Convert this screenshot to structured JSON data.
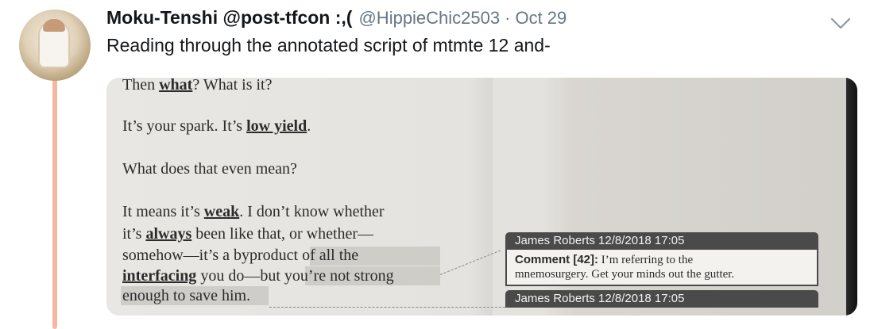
{
  "tweet": {
    "display_name": "Moku-Tenshi @post-tfcon :,(",
    "handle": "@HippieChic2503",
    "separator": "·",
    "date": "Oct 29",
    "text": "Reading through the annotated script of mtmte 12 and-",
    "thread_color": "#f4b8a2"
  },
  "media": {
    "lines": [
      {
        "pre": "Then ",
        "bold": "what",
        "post": "? What is it?"
      },
      {
        "pre": "It’s your spark. It’s ",
        "bold": "low yield",
        "post": "."
      },
      {
        "pre": "What does that even mean?",
        "bold": "",
        "post": ""
      },
      {
        "pre": "It means it’s ",
        "bold": "weak",
        "post": ". I don’t know whether"
      },
      {
        "pre": "it’s ",
        "bold": "always",
        "post": " been like that, or whether—"
      },
      {
        "pre": "somehow—it’s a byproduct of all the",
        "bold": "",
        "post": ""
      },
      {
        "pre": "",
        "bold": "interfacing",
        "post": " you do—but you’re not strong"
      },
      {
        "pre": "enough to save him.",
        "bold": "",
        "post": ""
      }
    ],
    "comment1": {
      "header": "James Roberts 12/8/2018 17:05",
      "label": "Comment [42]:",
      "text1": " I’m referring to the",
      "text2": "mnemosurgery. Get your minds out the gutter."
    },
    "comment2": {
      "header": "James Roberts 12/8/2018 17:05"
    }
  },
  "icons": {
    "caret": "chevron-down-icon"
  }
}
